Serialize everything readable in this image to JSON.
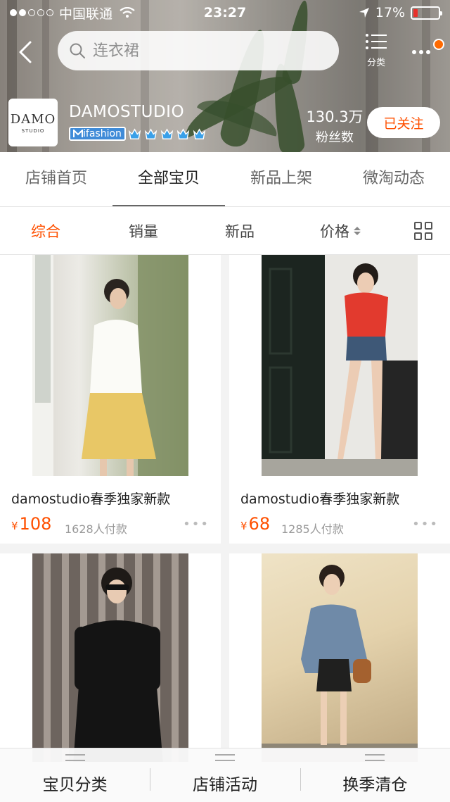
{
  "status_bar": {
    "carrier": "中国联通",
    "time": "23:27",
    "battery": "17%",
    "battery_level": 0.17,
    "signal_bars_filled": 2,
    "signal_bars_total": 5
  },
  "search": {
    "placeholder": "连衣裙",
    "category_label": "分类"
  },
  "shop": {
    "logo_line1": "DAMO",
    "logo_line2": "STUDIO",
    "name": "DAMOSTUDIO",
    "badge": "ifashion",
    "crown_count": 5,
    "fans_count": "130.3万",
    "fans_label": "粉丝数",
    "follow_label": "已关注"
  },
  "tabs": [
    {
      "label": "店铺首页",
      "active": false
    },
    {
      "label": "全部宝贝",
      "active": true
    },
    {
      "label": "新品上架",
      "active": false
    },
    {
      "label": "微淘动态",
      "active": false
    }
  ],
  "sorts": [
    {
      "label": "综合",
      "active": true
    },
    {
      "label": "销量",
      "active": false
    },
    {
      "label": "新品",
      "active": false
    },
    {
      "label": "价格",
      "active": false
    }
  ],
  "products": [
    {
      "title": "damostudio春季独家新款",
      "currency": "¥",
      "price": "108",
      "sales": "1628人付款"
    },
    {
      "title": "damostudio春季独家新款",
      "currency": "¥",
      "price": "68",
      "sales": "1285人付款"
    },
    {
      "title": "",
      "currency": "",
      "price": "",
      "sales": ""
    },
    {
      "title": "",
      "currency": "",
      "price": "",
      "sales": ""
    }
  ],
  "bottom_bar": [
    {
      "label": "宝贝分类"
    },
    {
      "label": "店铺活动"
    },
    {
      "label": "换季清仓"
    }
  ],
  "colors": {
    "accent": "#ff5000",
    "crown": "#3aa0e8"
  }
}
